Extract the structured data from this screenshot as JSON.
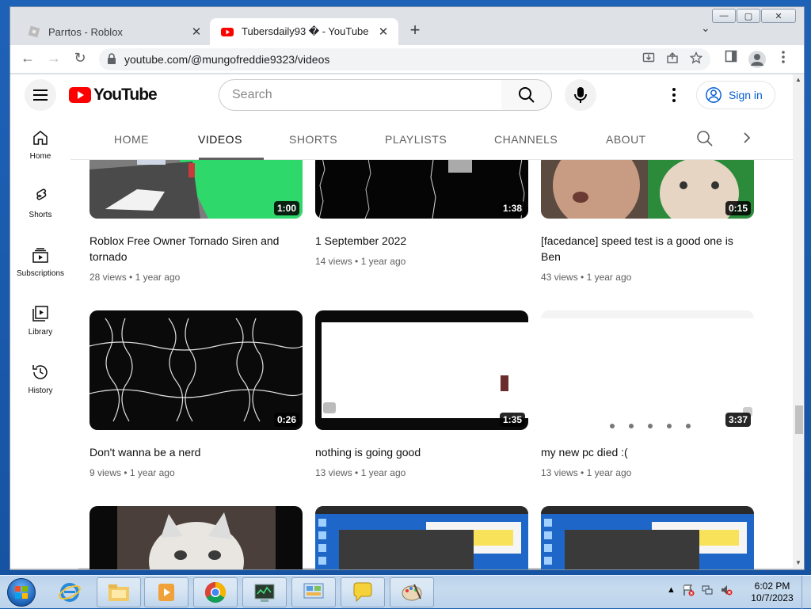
{
  "browser": {
    "tabs": [
      {
        "title": "Parrtos - Roblox",
        "close": "✕"
      },
      {
        "title": "Tubersdaily93 � - YouTube",
        "close": "✕"
      }
    ],
    "new_tab": "+",
    "tab_search": "⌄",
    "window_controls": {
      "minimize": "—",
      "maximize": "▢",
      "close": "✕"
    },
    "url": "youtube.com/@mungofreddie9323/videos",
    "nav": {
      "back": "←",
      "forward": "→",
      "reload": "↻"
    }
  },
  "youtube": {
    "logo_text": "YouTube",
    "search_placeholder": "Search",
    "sign_in": "Sign in",
    "guide": [
      {
        "label": "Home",
        "icon": "home-icon"
      },
      {
        "label": "Shorts",
        "icon": "shorts-icon"
      },
      {
        "label": "Subscriptions",
        "icon": "subscriptions-icon"
      },
      {
        "label": "Library",
        "icon": "library-icon"
      },
      {
        "label": "History",
        "icon": "history-icon"
      }
    ],
    "channel_tabs": [
      "HOME",
      "VIDEOS",
      "SHORTS",
      "PLAYLISTS",
      "CHANNELS",
      "ABOUT"
    ],
    "active_tab": "VIDEOS",
    "videos": [
      {
        "title": "Roblox Free Owner Tornado Siren and tornado",
        "views": "28 views",
        "age": "1 year ago",
        "duration": "1:00"
      },
      {
        "title": "1 September 2022",
        "views": "14 views",
        "age": "1 year ago",
        "duration": "1:38"
      },
      {
        "title": "[facedance] speed test is a good one is Ben 󠁿",
        "views": "43 views",
        "age": "1 year ago",
        "duration": "0:15"
      },
      {
        "title": "Don't wanna be a nerd",
        "views": "9 views",
        "age": "1 year ago",
        "duration": "0:26"
      },
      {
        "title": "nothing is going good",
        "views": "13 views",
        "age": "1 year ago",
        "duration": "1:35"
      },
      {
        "title": "my new pc died :(",
        "views": "13 views",
        "age": "1 year ago",
        "duration": "3:37"
      },
      {
        "title": "",
        "views": "",
        "age": "",
        "duration": ""
      },
      {
        "title": "",
        "views": "",
        "age": "",
        "duration": ""
      },
      {
        "title": "",
        "views": "",
        "age": "",
        "duration": ""
      }
    ],
    "meta_sep": "•"
  },
  "taskbar": {
    "time": "6:02 PM",
    "date": "10/7/2023"
  },
  "colors": {
    "yt_red": "#ff0000",
    "link_blue": "#065fd4",
    "text_secondary": "#606060"
  }
}
